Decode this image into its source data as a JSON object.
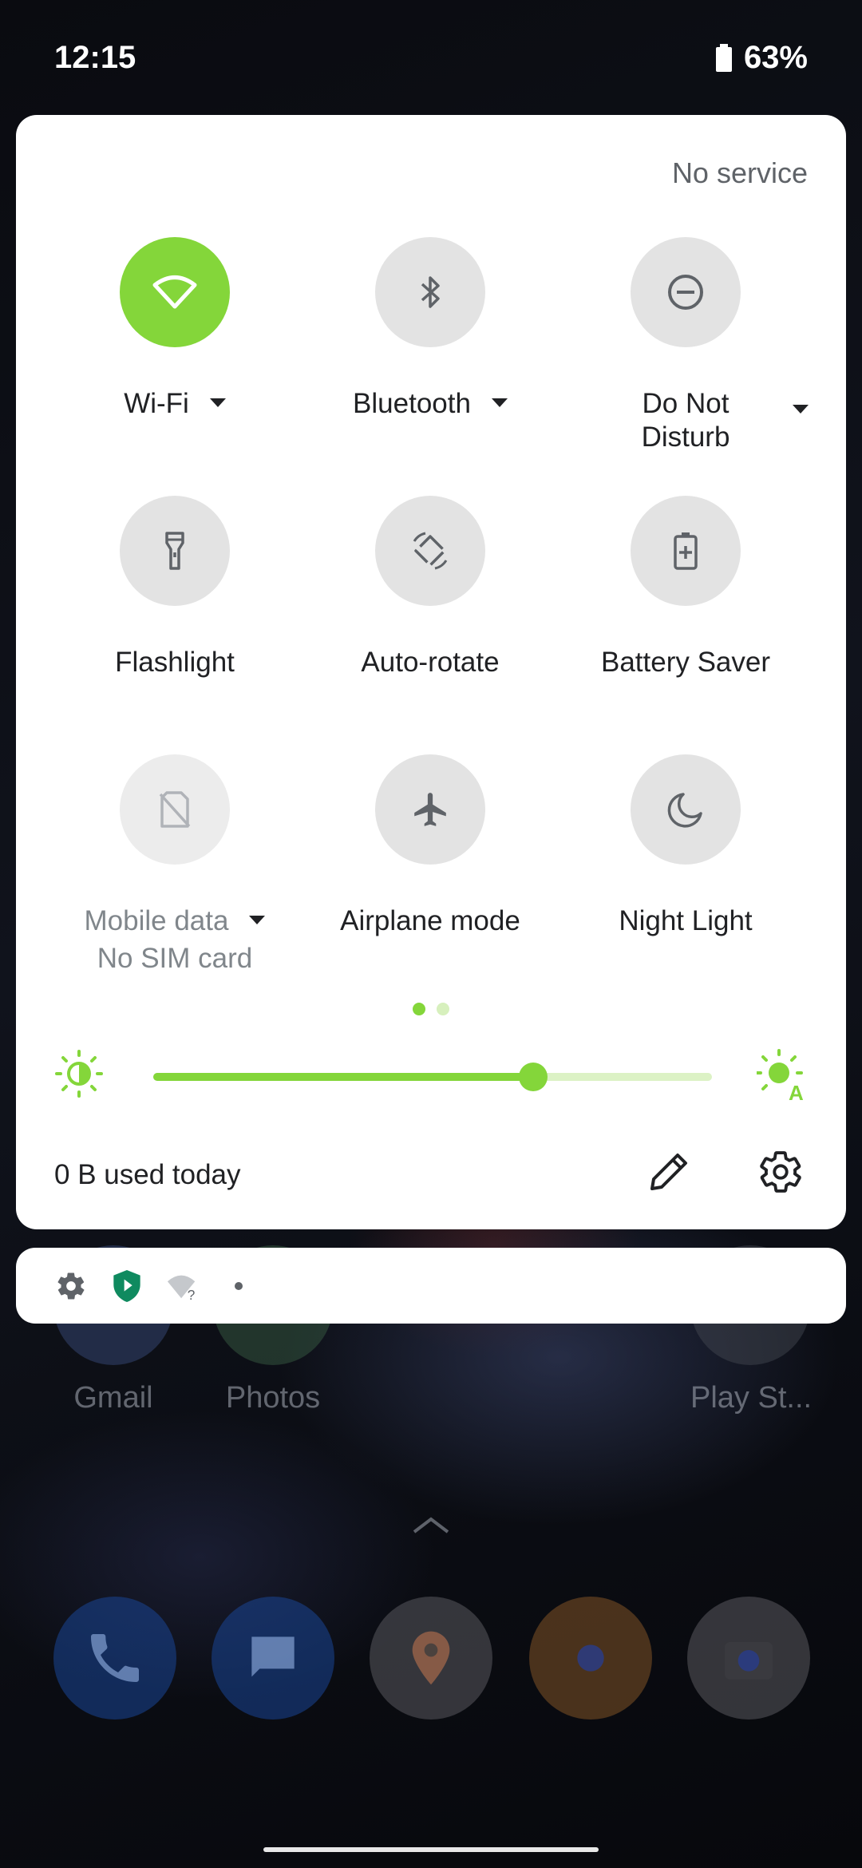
{
  "status_bar": {
    "time": "12:15",
    "battery_percent": "63%",
    "battery_icon": "battery-icon"
  },
  "quick_settings": {
    "carrier_text": "No service",
    "accent_color": "#84d63a",
    "tiles": [
      {
        "label": "Wi-Fi",
        "icon": "wifi-icon",
        "state": "on",
        "has_dropdown": true
      },
      {
        "label": "Bluetooth",
        "icon": "bluetooth-icon",
        "state": "off",
        "has_dropdown": true
      },
      {
        "label": "Do Not Disturb",
        "label_line1": "Do Not",
        "label_line2": "Disturb",
        "icon": "minus-circle-icon",
        "state": "off",
        "has_dropdown": true
      },
      {
        "label": "Flashlight",
        "icon": "flashlight-icon",
        "state": "off"
      },
      {
        "label": "Auto-rotate",
        "icon": "rotate-icon",
        "state": "off"
      },
      {
        "label": "Battery Saver",
        "icon": "battery-saver-icon",
        "state": "off"
      },
      {
        "label": "Mobile data",
        "sublabel": "No SIM card",
        "icon": "no-sim-icon",
        "state": "unavailable",
        "has_dropdown": true
      },
      {
        "label": "Airplane mode",
        "icon": "airplane-icon",
        "state": "off"
      },
      {
        "label": "Night Light",
        "icon": "moon-icon",
        "state": "off"
      }
    ],
    "pages": {
      "current": 1,
      "total": 2
    },
    "brightness": {
      "level": 0.68,
      "low_icon": "brightness-low-icon",
      "auto_icon": "brightness-auto-icon"
    },
    "data_usage": "0 B used today",
    "edit_icon": "edit-icon",
    "settings_icon": "settings-icon"
  },
  "notification_icons": [
    "settings-icon",
    "play-protect-icon",
    "wifi-question-icon",
    "dot-icon"
  ],
  "home_screen": {
    "apps": [
      {
        "label": "Gmail"
      },
      {
        "label": "Photos"
      },
      {
        "label": "Play St..."
      }
    ],
    "dock": [
      "phone-icon",
      "messages-icon",
      "maps-icon",
      "chrome-icon",
      "camera-go-icon"
    ]
  }
}
